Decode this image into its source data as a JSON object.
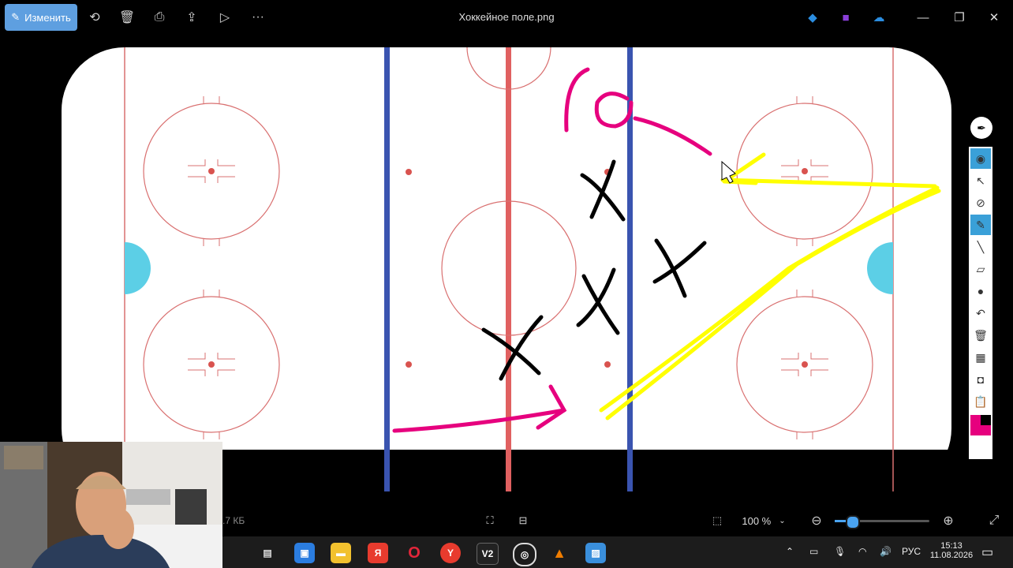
{
  "window": {
    "title": "Хоккейное поле.png",
    "edit_label": "Изменить"
  },
  "toolbar": {
    "icons": [
      "edit-icon",
      "rotate-icon",
      "delete-icon",
      "print-icon",
      "share-icon",
      "slideshow-icon",
      "more-icon"
    ]
  },
  "status": {
    "file_size": ".7 КБ",
    "zoom": "100 %"
  },
  "tray": {
    "language": "РУС",
    "time": "15:13",
    "date": "11.08.2026"
  },
  "taskbar": {
    "apps": [
      "task-view",
      "store",
      "explorer",
      "yandex",
      "opera",
      "yandex-browser",
      "v2",
      "obs",
      "vlc",
      "photos"
    ]
  },
  "colors": {
    "pink": "#e6007e",
    "yellow": "#ffff00",
    "blue_line": "#3a54b0",
    "red_line": "#d9534f",
    "crease": "#5ccfe6"
  }
}
